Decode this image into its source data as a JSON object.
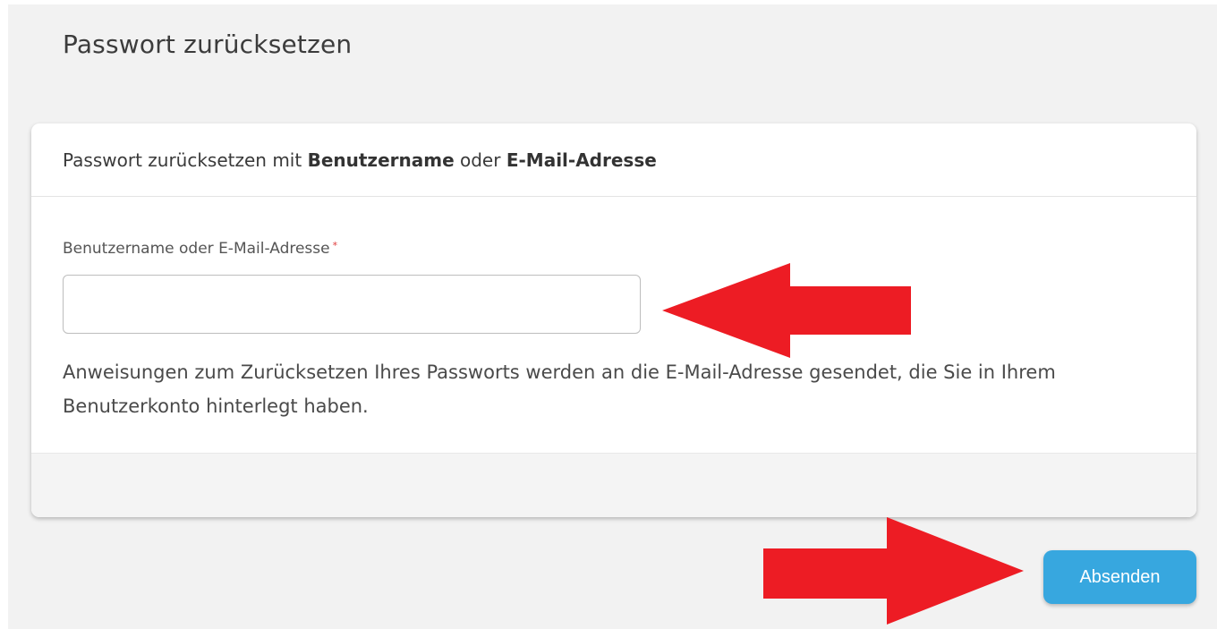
{
  "page": {
    "title": "Passwort zurücksetzen"
  },
  "card": {
    "header": {
      "prefix": "Passwort zurücksetzen mit ",
      "bold_1": "Benutzername",
      "middle": " oder ",
      "bold_2": "E-Mail-Adresse"
    },
    "field": {
      "label": "Benutzername oder E-Mail-Adresse",
      "required_marker": "*",
      "value": "",
      "placeholder": ""
    },
    "help_text": "Anweisungen zum Zurücksetzen Ihres Passworts werden an die E-Mail-Adresse gesendet, die Sie in Ihrem Benutzerkonto hinterlegt haben."
  },
  "actions": {
    "submit_label": "Absenden"
  },
  "annotations": {
    "arrow_color": "#ed1c24",
    "arrows": [
      "arrow-left-icon",
      "arrow-right-icon"
    ]
  },
  "colors": {
    "page_background": "#f2f2f2",
    "card_background": "#ffffff",
    "button_background": "#37a7df",
    "required_star": "#e03b3b"
  }
}
